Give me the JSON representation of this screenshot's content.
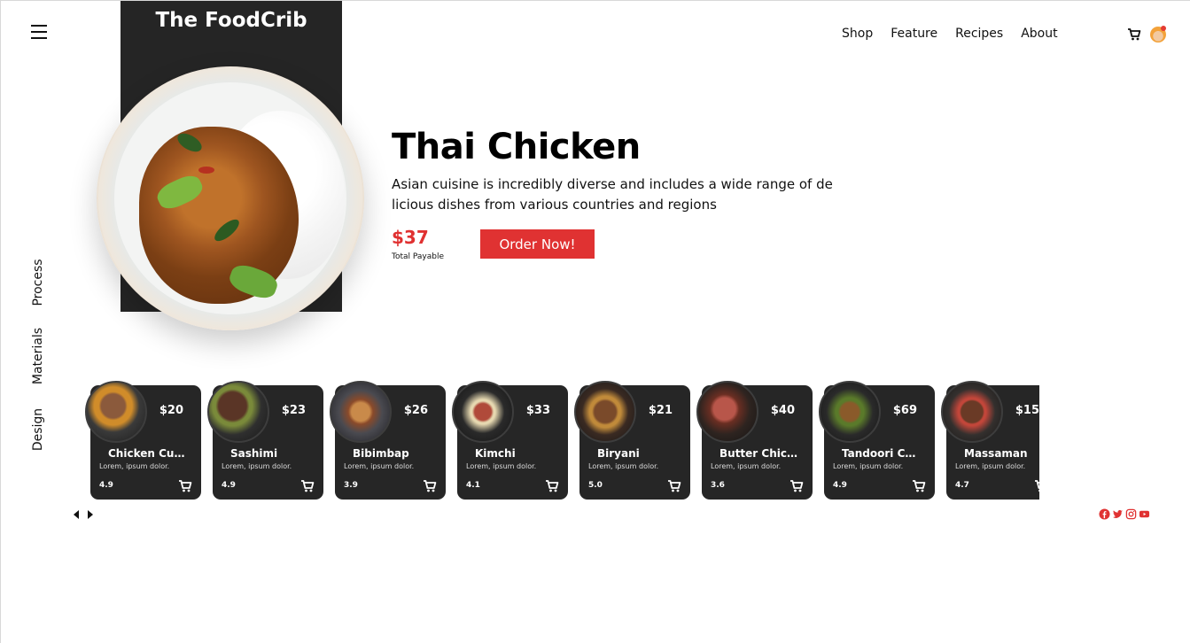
{
  "brand": {
    "title": "The FoodCrib"
  },
  "nav": {
    "items": [
      "Shop",
      "Feature",
      "Recipes",
      "About"
    ]
  },
  "side_nav": {
    "items": [
      "Process",
      "Materials",
      "Design"
    ]
  },
  "hero": {
    "title": "Thai Chicken",
    "description": "Asian cuisine is incredibly diverse and includes a wide range of delicious dishes from various countries and regions",
    "price": "$37",
    "price_label": "Total Payable",
    "order_button": "Order Now!"
  },
  "cards": [
    {
      "name": "Chicken Cur...",
      "price": "$20",
      "desc": "Lorem, ipsum dolor.",
      "rating": "4.9",
      "food": "steak-fries"
    },
    {
      "name": "Sashimi",
      "price": "$23",
      "desc": "Lorem, ipsum dolor.",
      "rating": "4.9",
      "food": "grilled-beef"
    },
    {
      "name": "Bibimbap",
      "price": "$26",
      "desc": "Lorem, ipsum dolor.",
      "rating": "3.9",
      "food": "noodles"
    },
    {
      "name": "Kimchi",
      "price": "$33",
      "desc": "Lorem, ipsum dolor.",
      "rating": "4.1",
      "food": "sliced-steak"
    },
    {
      "name": "Biryani",
      "price": "$21",
      "desc": "Lorem, ipsum dolor.",
      "rating": "5.0",
      "food": "roast-meat"
    },
    {
      "name": "Butter Chick...",
      "price": "$40",
      "desc": "Lorem, ipsum dolor.",
      "rating": "3.6",
      "food": "steak-slices"
    },
    {
      "name": "Tandoori Cu...",
      "price": "$69",
      "desc": "Lorem, ipsum dolor.",
      "rating": "4.9",
      "food": "stir-fry"
    },
    {
      "name": "Massaman",
      "price": "$15",
      "desc": "Lorem, ipsum dolor.",
      "rating": "4.7",
      "food": "grilled-steak"
    }
  ],
  "icons": {
    "menu": "hamburger-icon",
    "cart": "shopping-cart-icon",
    "profile": "user-avatar-icon",
    "prev": "arrow-left-icon",
    "next": "arrow-right-icon",
    "social": [
      "facebook-icon",
      "twitter-icon",
      "instagram-icon",
      "youtube-icon"
    ]
  },
  "colors": {
    "accent": "#e03232",
    "dark_panel": "#252525",
    "card_bg": "#262626",
    "price_red": "#e03131"
  }
}
